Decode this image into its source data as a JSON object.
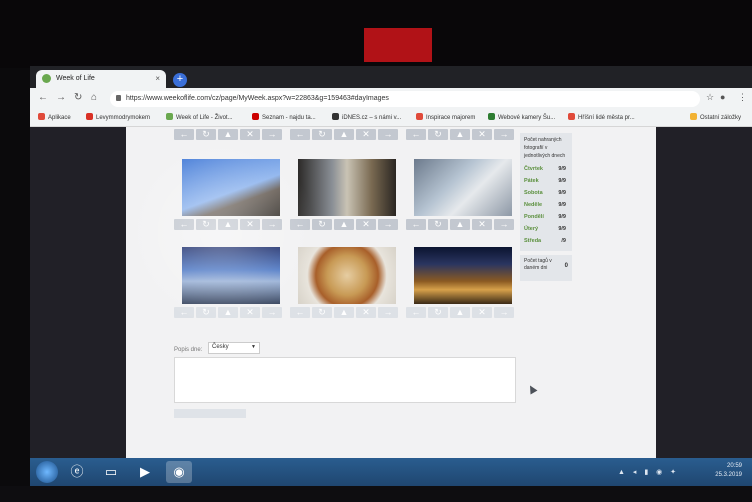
{
  "browser": {
    "tab_title": "Week of Life",
    "tab_close": "×",
    "new_tab": "+",
    "url": "https://www.weekoflife.com/cz/page/MyWeek.aspx?w=22863&g=159463#dayImages",
    "nav": {
      "back": "←",
      "forward": "→",
      "reload": "↻",
      "home": "⌂"
    },
    "bookmarks": [
      {
        "label": "Aplikace",
        "color": "#e04a3a"
      },
      {
        "label": "Levymmodrymokem",
        "color": "#d93025"
      },
      {
        "label": "Week of Life - Život...",
        "color": "#6aa84f"
      },
      {
        "label": "Seznam - najdu ta...",
        "color": "#cc0000"
      },
      {
        "label": "iDNES.cz – s námi v...",
        "color": "#333333"
      },
      {
        "label": "Inspirace majorem",
        "color": "#e04a3a"
      },
      {
        "label": "Webové kamery Šu...",
        "color": "#2e7d32"
      },
      {
        "label": "Hříšní lidé města pr...",
        "color": "#e04a3a"
      },
      {
        "label": "Ostatní záložky",
        "color": "#f2b233"
      }
    ]
  },
  "controls": {
    "left": "←",
    "rotate": "↻",
    "up": "▲",
    "delete": "✕",
    "right": "→"
  },
  "photos": [
    {
      "name": "photo-1",
      "desc": "person waving against blue sky"
    },
    {
      "name": "photo-2",
      "desc": "street with construction signs"
    },
    {
      "name": "photo-3",
      "desc": "tram window view of city"
    },
    {
      "name": "photo-4",
      "desc": "car window sky view"
    },
    {
      "name": "photo-5",
      "desc": "food plate"
    },
    {
      "name": "photo-6",
      "desc": "night street"
    }
  ],
  "sidebar": {
    "heading": "Počet nahraných fotografií v jednotlivých dnech",
    "days": [
      {
        "name": "Čtvrtek",
        "count": "9/9"
      },
      {
        "name": "Pátek",
        "count": "9/9"
      },
      {
        "name": "Sobota",
        "count": "9/9"
      },
      {
        "name": "Neděle",
        "count": "9/9"
      },
      {
        "name": "Pondělí",
        "count": "9/9"
      },
      {
        "name": "Úterý",
        "count": "9/9"
      },
      {
        "name": "Středa",
        "count": "/9"
      }
    ],
    "tags_label": "Počet tagů v daném dni",
    "tags_count": "0"
  },
  "description": {
    "label": "Popis dne:",
    "language": "Česky"
  },
  "taskbar": {
    "time": "20:59",
    "date": "25.3.2019"
  }
}
